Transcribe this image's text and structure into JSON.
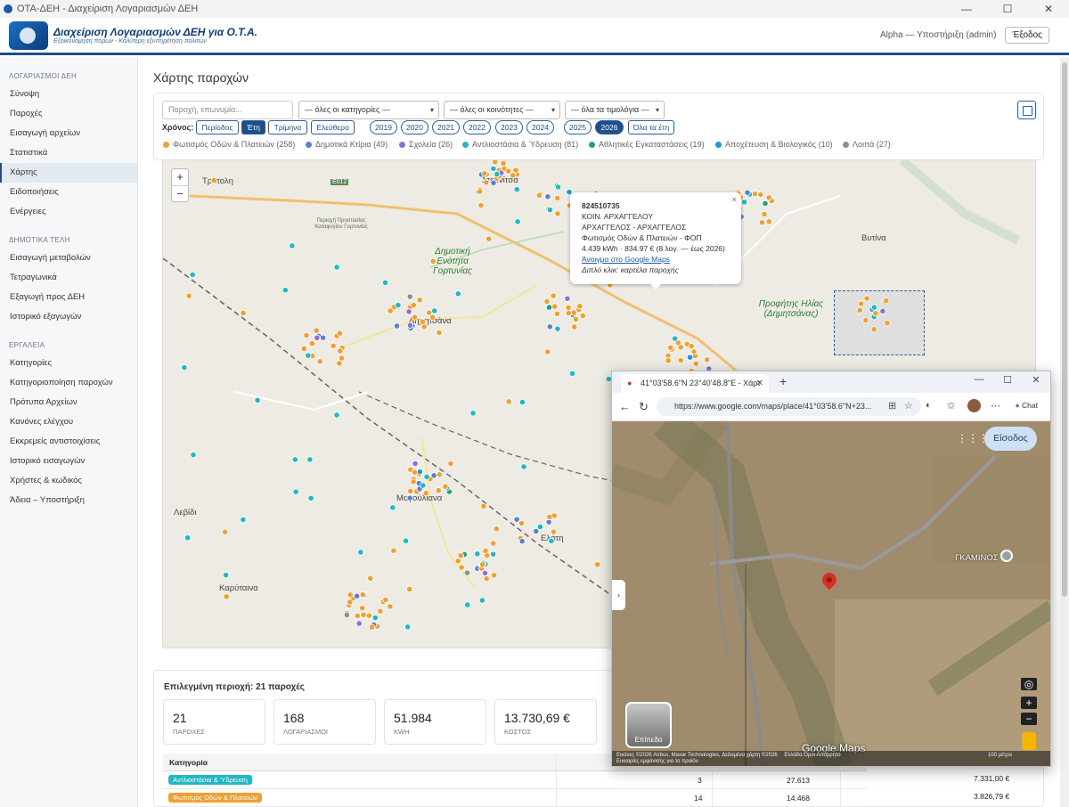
{
  "window": {
    "title": "ΟΤΑ-ΔΕΗ - Διαχείριση Λογαριασμών ΔΕΗ",
    "controls": [
      "—",
      "☐",
      "✕"
    ]
  },
  "header": {
    "logo_title": "Διαχείριση Λογαριασμών ΔΕΗ για Ο.Τ.Α.",
    "logo_subtitle": "Εξοικονόμηση πόρων - Καλύτερη εξυπηρέτηση πολιτών",
    "user": "Alpha — Υποστήριξη (admin)",
    "logout_label": "Έξοδος"
  },
  "sidebar": {
    "sections": [
      {
        "title": "ΛΟΓΑΡΙΑΣΜΟΙ ΔΕΗ",
        "items": [
          "Σύνοψη",
          "Παροχές",
          "Εισαγωγή αρχείων",
          "Στατιστικά",
          "Χάρτης",
          "Ειδοποιήσεις",
          "Ενέργειες"
        ]
      },
      {
        "title": "ΔΗΜΟΤΙΚΑ ΤΕΛΗ",
        "items": [
          "Εισαγωγή μεταβολών",
          "Τετραγωνικά",
          "Εξαγωγή προς ΔΕΗ",
          "Ιστορικό εξαγωγών"
        ]
      },
      {
        "title": "ΕΡΓΑΛΕΙΑ",
        "items": [
          "Κατηγορίες",
          "Κατηγοριοποίηση παροχών",
          "Πρότυπα Αρχείων",
          "Κανόνες ελέγχου",
          "Εκκρεμείς αντιστοιχίσεις",
          "Ιστορικό εισαγωγών",
          "Χρήστες & κωδικός",
          "Άδεια – Υποστήριξη"
        ]
      }
    ],
    "active_item": "Χάρτης"
  },
  "page": {
    "title": "Χάρτης παροχών"
  },
  "filters": {
    "search_placeholder": "Παροχή, επωνυμία...",
    "category_select": "— όλες οι κατηγορίες —",
    "community_select": "— όλες οι κοινότητες —",
    "invoice_select": "— όλα τα τιμολόγια —",
    "year_label": "Χρόνος:",
    "period_buttons": [
      "Περίοδος",
      "Έτη",
      "Τρίμηνα",
      "Ελεύθερο"
    ],
    "active_period": "Έτη",
    "years": [
      "2019",
      "2020",
      "2021",
      "2022",
      "2023",
      "2024",
      "2025",
      "2026"
    ],
    "active_year": "2026",
    "all_years_label": "Όλα τα έτη"
  },
  "legend": [
    {
      "label": "Φωτισμός Οδών & Πλατειών (258)",
      "color": "#f0a030"
    },
    {
      "label": "Δημοτικά Κτίρια (49)",
      "color": "#5b7fd6"
    },
    {
      "label": "Σχολεία (26)",
      "color": "#8e6fd8"
    },
    {
      "label": "Αντλιοστάσια & Ύδρευση (81)",
      "color": "#1fb8c6"
    },
    {
      "label": "Αθλητικές Εγκαταστάσεις (19)",
      "color": "#27a36a"
    },
    {
      "label": "Αποχέτευση & Βιολογικός (10)",
      "color": "#1a9ad6"
    },
    {
      "label": "Λοιπά (27)",
      "color": "#8e8e8e"
    }
  ],
  "map": {
    "zoom_in": "+",
    "zoom_out": "−",
    "places": [
      "Τρίπολη",
      "Στεμνίτσα",
      "Βυτίνα",
      "Δημητσάνα",
      "Μαγούλιανα",
      "Ελάτη",
      "Λεβίδι",
      "Καρύταινα",
      "E012"
    ],
    "region_labels": [
      "Δημοτική Ενότητα Γορτυνίας",
      "Προφήτης Ηλίας (Δημητσάνας)"
    ],
    "poi_label": "Περιοχή Προστασίας Καταφυγίου Γορτυνίας",
    "popup": {
      "id": "824510735",
      "line1": "ΚΟΙΝ. ΑΡΧΑΓΓΕΛΟΥ",
      "line2": "ΑΡΧΑΓΓΕΛΟΣ - ΑΡΧΑΓΓΕΛΟΣ",
      "line3": "Φωτισμός Οδών & Πλατειών - ΦΟΠ",
      "line4": "4.439 kWh · 834.97 € (8 λογ. — έως 2026)",
      "link": "Άνοιγμα στο Google Maps",
      "hint": "Διπλό κλικ: καρτέλα παροχής",
      "close": "×"
    }
  },
  "selection": {
    "title": "Επιλεγμένη περιοχή: 21 παροχές",
    "kpis": [
      {
        "value": "21",
        "label": "ΠΑΡΟΧΕΣ"
      },
      {
        "value": "168",
        "label": "ΛΟΓΑΡΙΑΣΜΟΙ"
      },
      {
        "value": "51.984",
        "label": "KWH"
      },
      {
        "value": "13.730,69 €",
        "label": "ΚΟΣΤΟΣ"
      }
    ],
    "table": {
      "header": "Κατηγορία",
      "rows": [
        {
          "category": "Αντλιοστάσια & Ύδρευση",
          "color": "#1fb8c6",
          "count": "3",
          "kwh": "27.613",
          "cost": "7.331,00 €"
        },
        {
          "category": "Φωτισμός Οδών & Πλατειών",
          "color": "#f0a030",
          "count": "14",
          "kwh": "14.468",
          "cost": "3.826,79 €"
        }
      ]
    }
  },
  "browser": {
    "tab_title": "41°03'58.6\"N 23°40'48.8\"E - Χάρτ",
    "url": "https://www.google.com/maps/place/41°03'58.6\"N+23...",
    "chat_label": "Chat",
    "signin_label": "Είσοδος",
    "place_label": "ΓΚΑΜΙΝΟΣ",
    "layers_label": "Επίπεδα",
    "brand": "Google Maps",
    "attribution": "Εικόνες ©2026 Airbus, Maxar Technologies, Δεδομένα χάρτη ©2026",
    "attribution_links": "Ελλάδα   Όροι   Απόρρητο",
    "attribution2": "Ευκαιρίες εμφάνισης για το προϊόν",
    "scale": "100 μέτρα"
  }
}
